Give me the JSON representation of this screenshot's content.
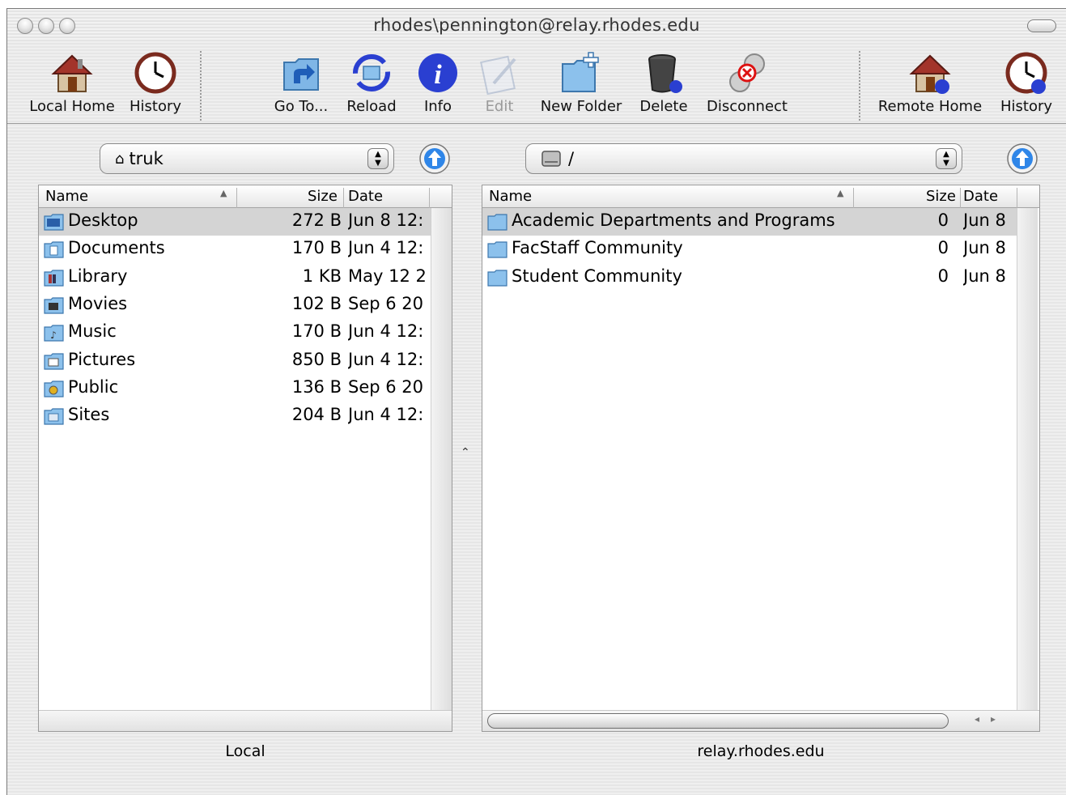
{
  "window": {
    "title": "rhodes\\pennington@relay.rhodes.edu"
  },
  "toolbar": {
    "local_home": "Local Home",
    "history_left": "History",
    "go_to": "Go To...",
    "reload": "Reload",
    "info": "Info",
    "edit": "Edit",
    "new_folder": "New Folder",
    "delete": "Delete",
    "disconnect": "Disconnect",
    "remote_home": "Remote Home",
    "history_right": "History"
  },
  "local": {
    "path": "truk",
    "columns": {
      "name": "Name",
      "size": "Size",
      "date": "Date"
    },
    "rows": [
      {
        "name": "Desktop",
        "size": "272 B",
        "date": "Jun 8 12:",
        "icon": "desktop-folder-icon"
      },
      {
        "name": "Documents",
        "size": "170 B",
        "date": "Jun 4 12:",
        "icon": "documents-folder-icon"
      },
      {
        "name": "Library",
        "size": "1 KB",
        "date": "May 12 2",
        "icon": "library-folder-icon"
      },
      {
        "name": "Movies",
        "size": "102 B",
        "date": "Sep 6 20",
        "icon": "movies-folder-icon"
      },
      {
        "name": "Music",
        "size": "170 B",
        "date": "Jun 4 12:",
        "icon": "music-folder-icon"
      },
      {
        "name": "Pictures",
        "size": "850 B",
        "date": "Jun 4 12:",
        "icon": "pictures-folder-icon"
      },
      {
        "name": "Public",
        "size": "136 B",
        "date": "Sep 6 20",
        "icon": "public-folder-icon"
      },
      {
        "name": "Sites",
        "size": "204 B",
        "date": "Jun 4 12:",
        "icon": "sites-folder-icon"
      }
    ],
    "label": "Local"
  },
  "remote": {
    "path": "/",
    "columns": {
      "name": "Name",
      "size": "Size",
      "date": "Date"
    },
    "rows": [
      {
        "name": "Academic Departments and Programs",
        "size": "0",
        "date": "Jun 8",
        "icon": "folder-icon"
      },
      {
        "name": "FacStaff Community",
        "size": "0",
        "date": "Jun 8",
        "icon": "folder-icon"
      },
      {
        "name": "Student Community",
        "size": "0",
        "date": "Jun 8",
        "icon": "folder-icon"
      }
    ],
    "label": "relay.rhodes.edu"
  },
  "colors": {
    "selection": "#d4d4d4",
    "info_blue": "#2a3fd1",
    "up_arrow_blue": "#2f86e8",
    "folder_blue": "#8cc1ec"
  }
}
